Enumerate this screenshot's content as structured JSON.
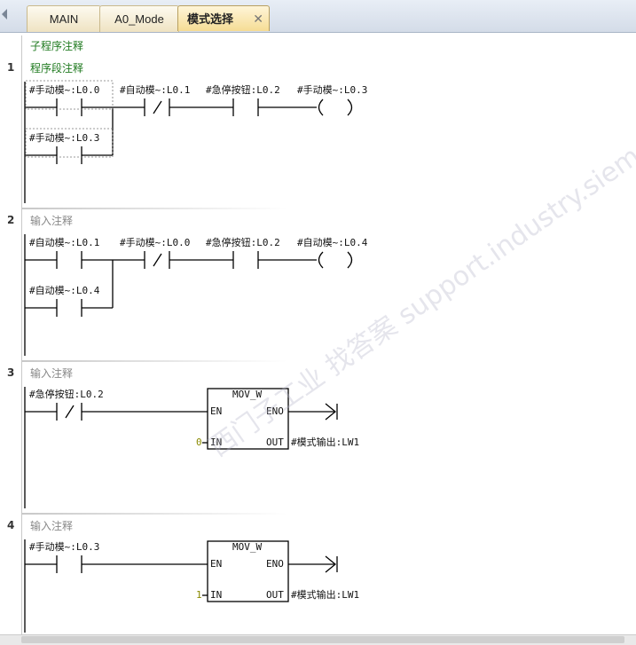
{
  "tabs": [
    {
      "label": "MAIN"
    },
    {
      "label": "A0_Mode"
    },
    {
      "label": "模式选择",
      "close": "✕"
    }
  ],
  "subroutine_comment": "子程序注释",
  "networks": [
    {
      "num": "1",
      "comment": "程序段注释",
      "row1": [
        "#手动模~:L0.0",
        "#自动模~:L0.1",
        "#急停按钮:L0.2",
        "#手动模~:L0.3"
      ],
      "row2": "#手动模~:L0.3"
    },
    {
      "num": "2",
      "comment": "输入注释",
      "row1": [
        "#自动模~:L0.1",
        "#手动模~:L0.0",
        "#急停按钮:L0.2",
        "#自动模~:L0.4"
      ],
      "row2": "#自动模~:L0.4"
    },
    {
      "num": "3",
      "comment": "输入注释",
      "contact": "#急停按钮:L0.2",
      "box": {
        "title": "MOV_W",
        "en": "EN",
        "eno": "ENO",
        "in": "IN",
        "out": "OUT"
      },
      "in_value": "0",
      "out_label": "#模式输出:LW1"
    },
    {
      "num": "4",
      "comment": "输入注释",
      "contact": "#手动模~:L0.3",
      "box": {
        "title": "MOV_W",
        "en": "EN",
        "eno": "ENO",
        "in": "IN",
        "out": "OUT"
      },
      "in_value": "1",
      "out_label": "#模式输出:LW1"
    }
  ],
  "watermark": "西门子工业  找答案  support.industry.siemens.com/cs",
  "colors": {
    "comment_green": "#1f7a1f",
    "comment_gray": "#888888",
    "in_value": "#8a8a00"
  }
}
